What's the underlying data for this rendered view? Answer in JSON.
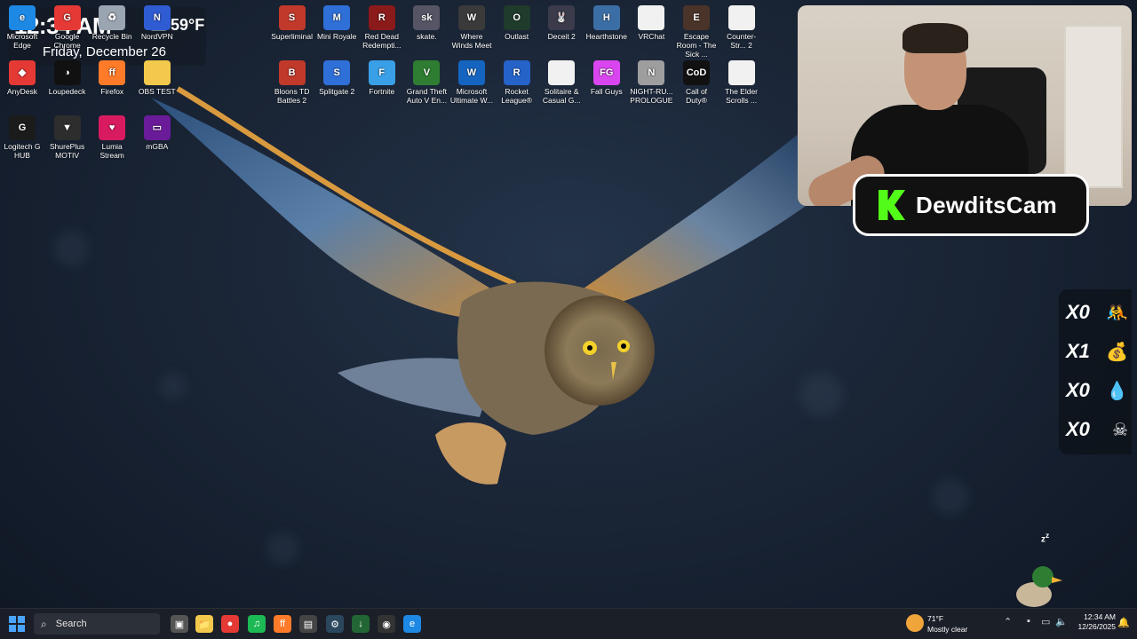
{
  "clock_widget": {
    "time": "12:34 AM",
    "temperature": "59°F",
    "date": "Friday, December 26"
  },
  "desktop_icons": [
    {
      "label": "Microsoft Edge",
      "color": "#1e88e5",
      "glyph": "e"
    },
    {
      "label": "Google Chrome",
      "color": "#e53935",
      "glyph": "G"
    },
    {
      "label": "Recycle Bin",
      "color": "#9aa5b1",
      "glyph": "♻"
    },
    {
      "label": "NordVPN",
      "color": "#2f5bd3",
      "glyph": "N"
    },
    {
      "label": "Superliminal",
      "color": "#c0392b",
      "glyph": "S"
    },
    {
      "label": "Mini Royale",
      "color": "#2f6fd8",
      "glyph": "M"
    },
    {
      "label": "Red Dead Redempti...",
      "color": "#8b1a1a",
      "glyph": "R"
    },
    {
      "label": "skate.",
      "color": "#556",
      "glyph": "sk"
    },
    {
      "label": "Where Winds Meet",
      "color": "#3a3a3a",
      "glyph": "W"
    },
    {
      "label": "Outlast",
      "color": "#1f3b2b",
      "glyph": "O"
    },
    {
      "label": "Deceit 2",
      "color": "#3b3b4b",
      "glyph": "🐰"
    },
    {
      "label": "Hearthstone",
      "color": "#3b6ea5",
      "glyph": "H"
    },
    {
      "label": "VRChat",
      "color": "#f1f1f1",
      "glyph": ""
    },
    {
      "label": "Escape Room - The Sick ...",
      "color": "#4a3328",
      "glyph": "E"
    },
    {
      "label": "Counter-Str... 2",
      "color": "#f1f1f1",
      "glyph": ""
    },
    {
      "label": "AnyDesk",
      "color": "#e53935",
      "glyph": "◆"
    },
    {
      "label": "Loupedeck",
      "color": "#111",
      "glyph": "◑"
    },
    {
      "label": "Firefox",
      "color": "#ff7b2a",
      "glyph": "ff"
    },
    {
      "label": "OBS TEST",
      "color": "#f2c94c",
      "glyph": ""
    },
    {
      "label": "Bloons TD Battles 2",
      "color": "#c0392b",
      "glyph": "B"
    },
    {
      "label": "Splitgate 2",
      "color": "#2f6fd8",
      "glyph": "S"
    },
    {
      "label": "Fortnite",
      "color": "#39a0e8",
      "glyph": "F"
    },
    {
      "label": "Grand Theft Auto V En...",
      "color": "#2e7d32",
      "glyph": "V"
    },
    {
      "label": "Microsoft Ultimate W...",
      "color": "#1565c0",
      "glyph": "W"
    },
    {
      "label": "Rocket League®",
      "color": "#2563c9",
      "glyph": "R"
    },
    {
      "label": "Solitaire & Casual G...",
      "color": "#f1f1f1",
      "glyph": ""
    },
    {
      "label": "Fall Guys",
      "color": "#d946ef",
      "glyph": "FG"
    },
    {
      "label": "NIGHT-RU... PROLOGUE",
      "color": "#9e9e9e",
      "glyph": "N"
    },
    {
      "label": "Call of Duty®",
      "color": "#111",
      "glyph": "CoD"
    },
    {
      "label": "The Elder Scrolls ...",
      "color": "#f1f1f1",
      "glyph": ""
    },
    {
      "label": "Logitech G HUB",
      "color": "#1b1b1b",
      "glyph": "G"
    },
    {
      "label": "ShurePlus MOTIV",
      "color": "#2d2d2d",
      "glyph": "▼"
    },
    {
      "label": "Lumia Stream",
      "color": "#d81b60",
      "glyph": "♥"
    },
    {
      "label": "mGBA",
      "color": "#6a1b9a",
      "glyph": "▭"
    }
  ],
  "kick_badge": {
    "name": "DewditsCam",
    "brand_color": "#53fc18"
  },
  "counters": [
    {
      "value": "X0",
      "icon": "🤼"
    },
    {
      "value": "X1",
      "icon": "💰"
    },
    {
      "value": "X0",
      "icon": "💧"
    },
    {
      "value": "X0",
      "icon": "☠"
    }
  ],
  "taskbar": {
    "search_label": "Search",
    "apps": [
      {
        "name": "task-view",
        "glyph": "▣",
        "color": "#555"
      },
      {
        "name": "file-explorer",
        "glyph": "📁",
        "color": "#f2c94c"
      },
      {
        "name": "chrome",
        "glyph": "●",
        "color": "#e53935"
      },
      {
        "name": "spotify",
        "glyph": "♫",
        "color": "#1db954"
      },
      {
        "name": "firefox",
        "glyph": "ff",
        "color": "#ff7b2a"
      },
      {
        "name": "app-dark",
        "glyph": "▤",
        "color": "#444"
      },
      {
        "name": "steam",
        "glyph": "⚙",
        "color": "#2a475e"
      },
      {
        "name": "app-green",
        "glyph": "↓",
        "color": "#263"
      },
      {
        "name": "obs",
        "glyph": "◉",
        "color": "#333"
      },
      {
        "name": "edge",
        "glyph": "e",
        "color": "#1e88e5"
      }
    ],
    "weather_temp": "71°F",
    "weather_desc": "Mostly clear",
    "time": "12:34 AM",
    "date": "12/26/2025"
  }
}
